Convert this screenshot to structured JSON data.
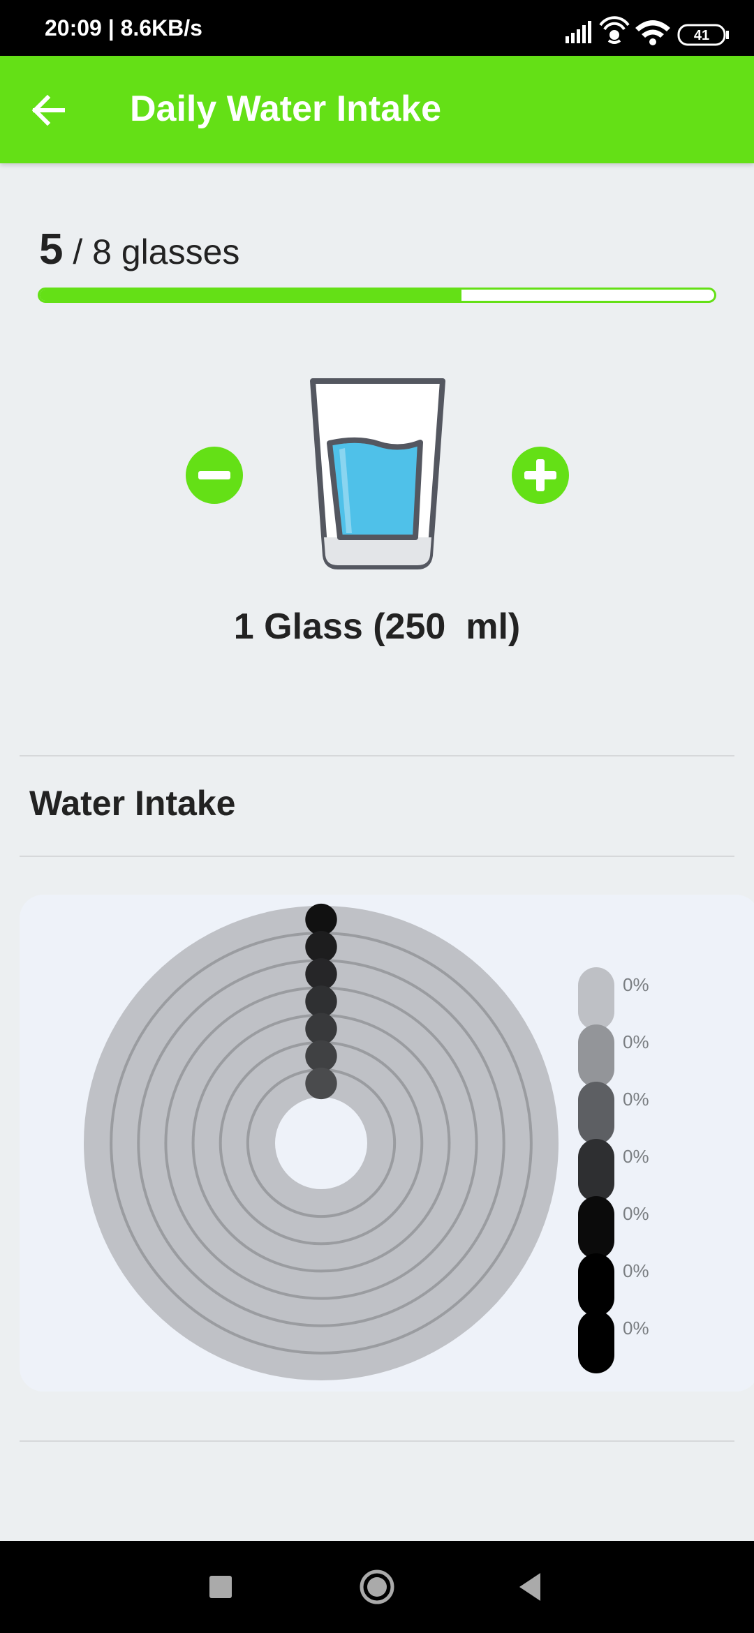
{
  "status_bar": {
    "time_and_speed": "20:09 | 8.6KB/s",
    "battery": "41"
  },
  "app_bar": {
    "title": "Daily Water Intake"
  },
  "progress": {
    "current": "5",
    "total_text": "/ 8 glasses",
    "current_value": 5,
    "goal": 8,
    "fill_fraction": 0.625
  },
  "glass": {
    "label": "1 Glass (250  ml)"
  },
  "section": {
    "title": "Water Intake"
  },
  "chart_data": {
    "type": "radial-bar",
    "series": [
      {
        "label": "0%",
        "value": 0,
        "color": "#BEC0C5"
      },
      {
        "label": "0%",
        "value": 0,
        "color": "#939599"
      },
      {
        "label": "0%",
        "value": 0,
        "color": "#5D5F63"
      },
      {
        "label": "0%",
        "value": 0,
        "color": "#2E2F31"
      },
      {
        "label": "0%",
        "value": 0,
        "color": "#0B0B0B"
      },
      {
        "label": "0%",
        "value": 0,
        "color": "#000000"
      },
      {
        "label": "0%",
        "value": 0,
        "color": "#000000"
      }
    ]
  },
  "colors": {
    "accent": "#64E016",
    "background": "#ECEFF1",
    "water": "#4FC1E9"
  }
}
